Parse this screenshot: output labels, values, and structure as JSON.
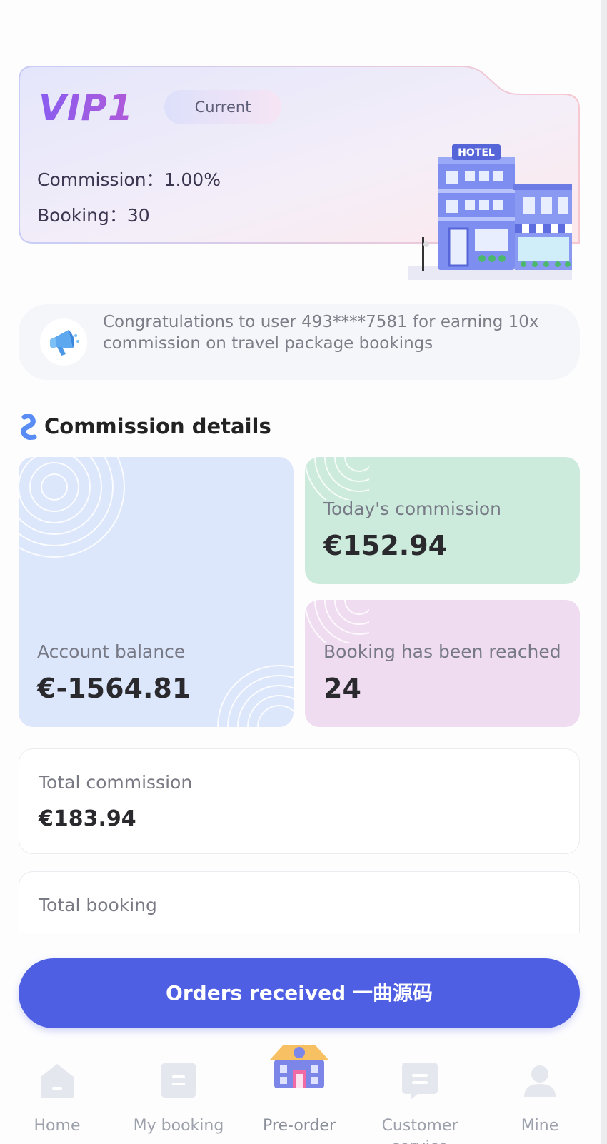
{
  "vip": {
    "level": "VIP1",
    "badge": "Current",
    "commission_line": "Commission：1.00%",
    "booking_line": "Booking：30",
    "hotel_sign": "HOTEL"
  },
  "notice": {
    "icon": "megaphone-icon",
    "text": "Congratulations to user 493****7581 for earning 10x commission on travel package bookings"
  },
  "commission_details": {
    "title": "Commission details",
    "account_balance_label": "Account balance",
    "account_balance_value": "€-1564.81",
    "todays_commission_label": "Today's commission",
    "todays_commission_value": "€152.94",
    "booking_reached_label": "Booking has been reached",
    "booking_reached_value": "24"
  },
  "totals": {
    "total_commission_label": "Total commission",
    "total_commission_value": "€183.94",
    "total_booking_label": "Total booking"
  },
  "cta": {
    "label": "Orders received 一曲源码"
  },
  "tabbar": {
    "items": [
      {
        "label": "Home",
        "icon": "home-icon"
      },
      {
        "label": "My booking",
        "icon": "booking-list-icon"
      },
      {
        "label": "Pre-order",
        "icon": "hotel-icon"
      },
      {
        "label": "Customer service",
        "icon": "chat-icon"
      },
      {
        "label": "Mine",
        "icon": "user-icon"
      }
    ]
  },
  "colors": {
    "accent": "#4f5fe3",
    "balance_card": "#dde7fb",
    "today_card": "#cdebdc",
    "reached_card": "#f0dcf1"
  }
}
